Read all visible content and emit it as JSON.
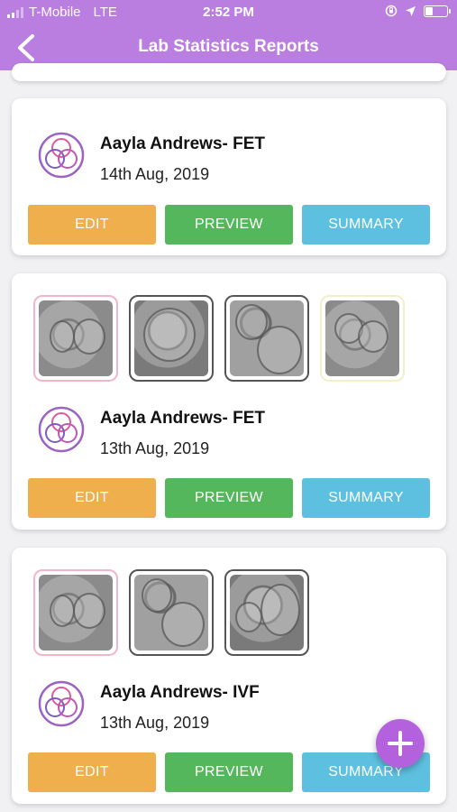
{
  "status_bar": {
    "carrier": "T-Mobile",
    "network": "LTE",
    "time": "2:52 PM",
    "battery_level": 0.3
  },
  "header": {
    "title": "Lab Statistics Reports"
  },
  "colors": {
    "header": "#b97ee0",
    "edit": "#eeaf4c",
    "preview": "#55b75b",
    "summary": "#5ec0e0",
    "fab": "#b461de"
  },
  "reports": [
    {
      "name": "Aayla Andrews- FET",
      "date": "14th Aug, 2019",
      "images": [],
      "edit_label": "EDIT",
      "preview_label": "PREVIEW",
      "summary_label": "SUMMARY"
    },
    {
      "name": "Aayla Andrews- FET",
      "date": "13th Aug, 2019",
      "images": [
        "embryo-image",
        "embryo-image",
        "embryo-image",
        "embryo-image"
      ],
      "edit_label": "EDIT",
      "preview_label": "PREVIEW",
      "summary_label": "SUMMARY"
    },
    {
      "name": "Aayla Andrews- IVF",
      "date": "13th Aug, 2019",
      "images": [
        "embryo-image",
        "embryo-image",
        "embryo-image"
      ],
      "edit_label": "EDIT",
      "preview_label": "PREVIEW",
      "summary_label": "SUMMARY"
    }
  ]
}
